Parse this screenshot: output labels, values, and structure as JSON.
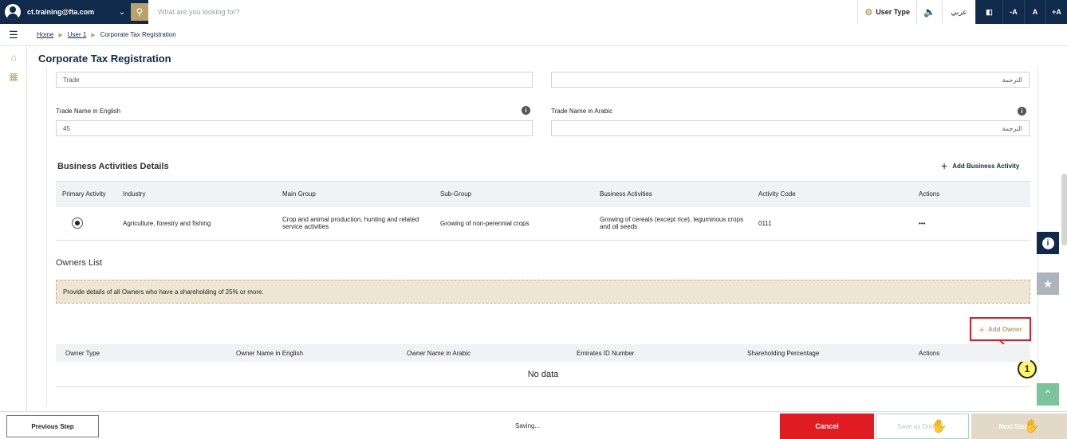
{
  "topbar": {
    "email": "ct.training@fta.com",
    "search_placeholder": "What are you looking for?",
    "user_type": "User Type",
    "language": "عربي",
    "font_decrease": "-A",
    "font_normal": "A",
    "font_increase": "+A"
  },
  "breadcrumb": {
    "home": "Home",
    "user": "User 1",
    "current": "Corporate Tax Registration"
  },
  "page_title": "Corporate Tax Registration",
  "trade": {
    "trade_value": "Trade",
    "trade_arabic_placeholder": "الترجمة",
    "name_en_label": "Trade Name in English",
    "name_en_value": "45",
    "name_ar_label": "Trade Name in Arabic",
    "name_ar_value": "الترجمة"
  },
  "business": {
    "title": "Business Activities Details",
    "add_label": "Add Business Activity",
    "columns": [
      "Primary Activity",
      "Industry",
      "Main Group",
      "Sub-Group",
      "Business Activities",
      "Activity Code",
      "Actions"
    ],
    "rows": [
      {
        "industry": "Agriculture, forestry and fishing",
        "main_group": "Crop and animal production, hunting and related service activities",
        "sub_group": "Growing of non-perennial crops",
        "activities": "Growing of cereals (except rice), leguminous crops and oil seeds",
        "code": "0111",
        "actions": "•••"
      }
    ]
  },
  "owners": {
    "title": "Owners List",
    "notice": "Provide details of all Owners who have a shareholding of 25% or more.",
    "add_label": "Add Owner",
    "columns": [
      "Owner Type",
      "Owner Name in English",
      "Owner Name in Arabic",
      "Emirates ID Number",
      "Shareholding Percentage",
      "Actions"
    ],
    "empty": "No data"
  },
  "callout_number": "1",
  "footer": {
    "previous": "Previous Step",
    "status": "Saving...",
    "cancel": "Cancel",
    "save": "Save as Draft",
    "next": "Next Step"
  }
}
